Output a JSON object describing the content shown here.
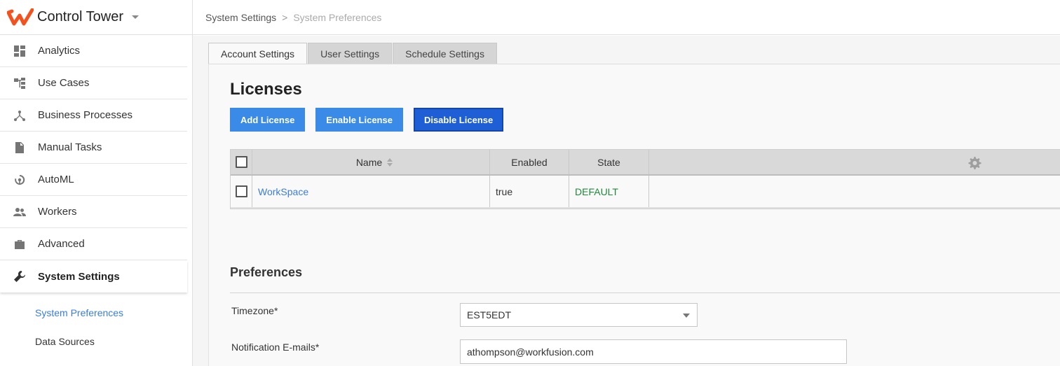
{
  "app": {
    "title": "Control Tower",
    "accent": "#f4511e"
  },
  "sidebar": {
    "items": [
      {
        "label": "Analytics",
        "icon": "dashboard-icon"
      },
      {
        "label": "Use Cases",
        "icon": "hierarchy-icon"
      },
      {
        "label": "Business Processes",
        "icon": "process-fork-icon"
      },
      {
        "label": "Manual Tasks",
        "icon": "document-icon"
      },
      {
        "label": "AutoML",
        "icon": "automl-icon"
      },
      {
        "label": "Workers",
        "icon": "people-icon"
      },
      {
        "label": "Advanced",
        "icon": "briefcase-icon"
      },
      {
        "label": "System Settings",
        "icon": "wrench-icon",
        "active": true
      }
    ],
    "subitems": [
      {
        "label": "System Preferences",
        "active": true
      },
      {
        "label": "Data Sources"
      }
    ]
  },
  "breadcrumb": {
    "parent": "System Settings",
    "separator": ">",
    "current": "System Preferences"
  },
  "tabs": [
    {
      "label": "Account Settings",
      "active": true
    },
    {
      "label": "User Settings"
    },
    {
      "label": "Schedule Settings"
    }
  ],
  "licenses": {
    "title": "Licenses",
    "buttons": {
      "add": "Add License",
      "enable": "Enable License",
      "disable": "Disable License"
    },
    "columns": {
      "name": "Name",
      "enabled": "Enabled",
      "state": "State"
    },
    "rows": [
      {
        "name": "WorkSpace",
        "enabled": "true",
        "state": "DEFAULT"
      }
    ]
  },
  "preferences": {
    "title": "Preferences",
    "timezone": {
      "label": "Timezone*",
      "value": "EST5EDT"
    },
    "notification_emails": {
      "label": "Notification E-mails*",
      "value": "athompson@workfusion.com"
    }
  },
  "colors": {
    "primary_button": "#3a8be8",
    "link": "#3b7ddd",
    "state_default": "#1f8a3a"
  }
}
